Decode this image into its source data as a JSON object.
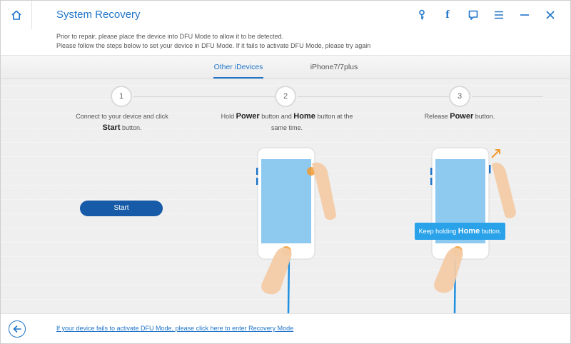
{
  "app": {
    "title": "System Recovery"
  },
  "titlebar": {
    "icons": [
      "key-icon",
      "facebook-icon",
      "feedback-icon",
      "menu-icon",
      "minimize-icon",
      "close-icon"
    ],
    "fb_glyph": "f"
  },
  "instructions": {
    "line1": "Prior to repair, please place the device into DFU Mode to allow it to be detected.",
    "line2": "Please follow the steps below to set your device in DFU Mode. If it fails to activate DFU Mode, please try again"
  },
  "tabs": [
    {
      "label": "Other iDevices",
      "active": true
    },
    {
      "label": "iPhone7/7plus",
      "active": false
    }
  ],
  "steps": [
    {
      "number": "1",
      "pre": "Connect to your device and click",
      "bold1": "Start",
      "mid": "button.",
      "bold2": "",
      "post": ""
    },
    {
      "number": "2",
      "pre": "Hold",
      "bold1": "Power",
      "mid": "button and",
      "bold2": "Home",
      "post": "button at the same time."
    },
    {
      "number": "3",
      "pre": "Release",
      "bold1": "Power",
      "mid": "button.",
      "bold2": "",
      "post": ""
    }
  ],
  "start_button": {
    "label": "Start"
  },
  "tooltip": {
    "pre": "Keep holding",
    "bold": "Home",
    "post": "button."
  },
  "footer": {
    "link": "If your device fails to activate DFU Mode, please click here to enter Recovery Mode"
  },
  "colors": {
    "accent": "#1f74c8",
    "button": "#165aa8",
    "tooltip": "#2aa2ea",
    "screen": "#8ec9ef",
    "finger": "#f3cba6",
    "highlight": "#f29a2e"
  }
}
